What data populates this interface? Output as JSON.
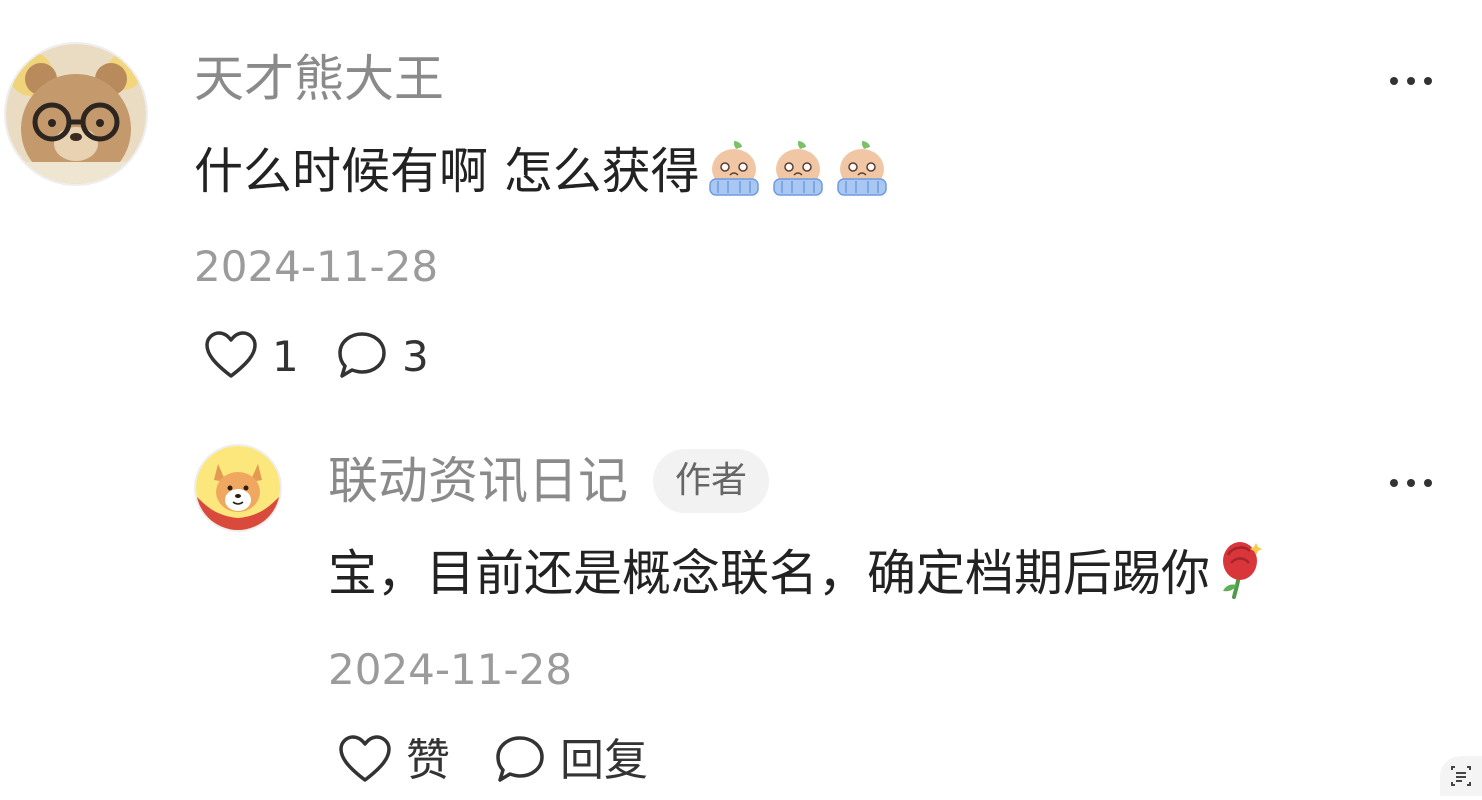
{
  "comment": {
    "username": "天才熊大王",
    "text": "什么时候有啊 怎么获得",
    "stickers": [
      "crying-sticker",
      "crying-sticker",
      "crying-sticker"
    ],
    "date": "2024-11-28",
    "like_icon": "heart-outline-icon",
    "like_count": "1",
    "reply_icon": "speech-bubble-icon",
    "reply_count": "3"
  },
  "reply": {
    "username": "联动资讯日记",
    "badge": "作者",
    "text": "宝，目前还是概念联名，确定档期后踢你",
    "emoji": "rose-emoji",
    "date": "2024-11-28",
    "like_label": "赞",
    "reply_label": "回复"
  },
  "colors": {
    "username": "#8a8a8a",
    "text": "#222222",
    "meta": "#9b9b9b",
    "badge_bg": "#f2f2f2"
  }
}
